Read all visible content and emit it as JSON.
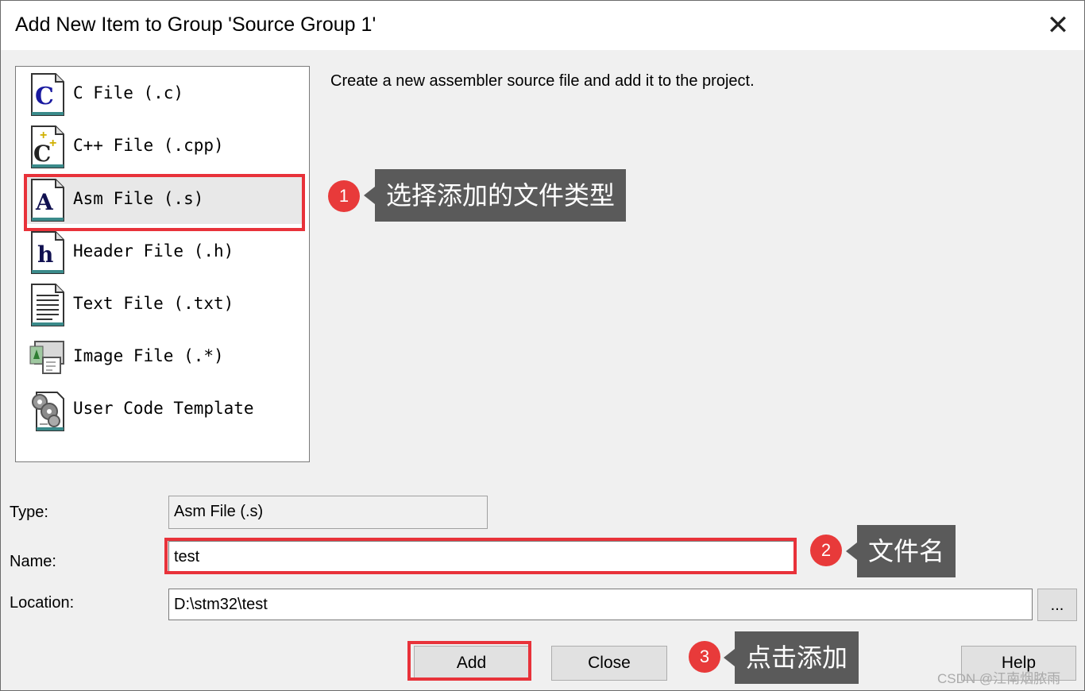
{
  "dialog": {
    "title": "Add New Item to Group 'Source Group 1'",
    "close_label": "✕",
    "description": "Create a new assembler source file and add it to the project."
  },
  "file_types": [
    {
      "label": "C File (.c)",
      "icon": "c-file-icon"
    },
    {
      "label": "C++ File (.cpp)",
      "icon": "cpp-file-icon"
    },
    {
      "label": "Asm File (.s)",
      "icon": "asm-file-icon",
      "selected": true
    },
    {
      "label": "Header File (.h)",
      "icon": "header-file-icon"
    },
    {
      "label": "Text File (.txt)",
      "icon": "text-file-icon"
    },
    {
      "label": "Image File (.*)",
      "icon": "image-file-icon"
    },
    {
      "label": "User Code Template",
      "icon": "gears-template-icon"
    }
  ],
  "form": {
    "type_label": "Type:",
    "type_value": "Asm File (.s)",
    "name_label": "Name:",
    "name_value": "test",
    "location_label": "Location:",
    "location_value": "D:\\stm32\\test",
    "browse_label": "..."
  },
  "buttons": {
    "add": "Add",
    "close": "Close",
    "help": "Help"
  },
  "annotations": [
    {
      "number": "1",
      "text": "选择添加的文件类型"
    },
    {
      "number": "2",
      "text": "文件名"
    },
    {
      "number": "3",
      "text": "点击添加"
    }
  ],
  "watermark": "CSDN @江南烟脓雨",
  "colors": {
    "highlight": "#e8323a",
    "callout_bg": "#5a5a5a",
    "badge": "#e83a3a"
  }
}
